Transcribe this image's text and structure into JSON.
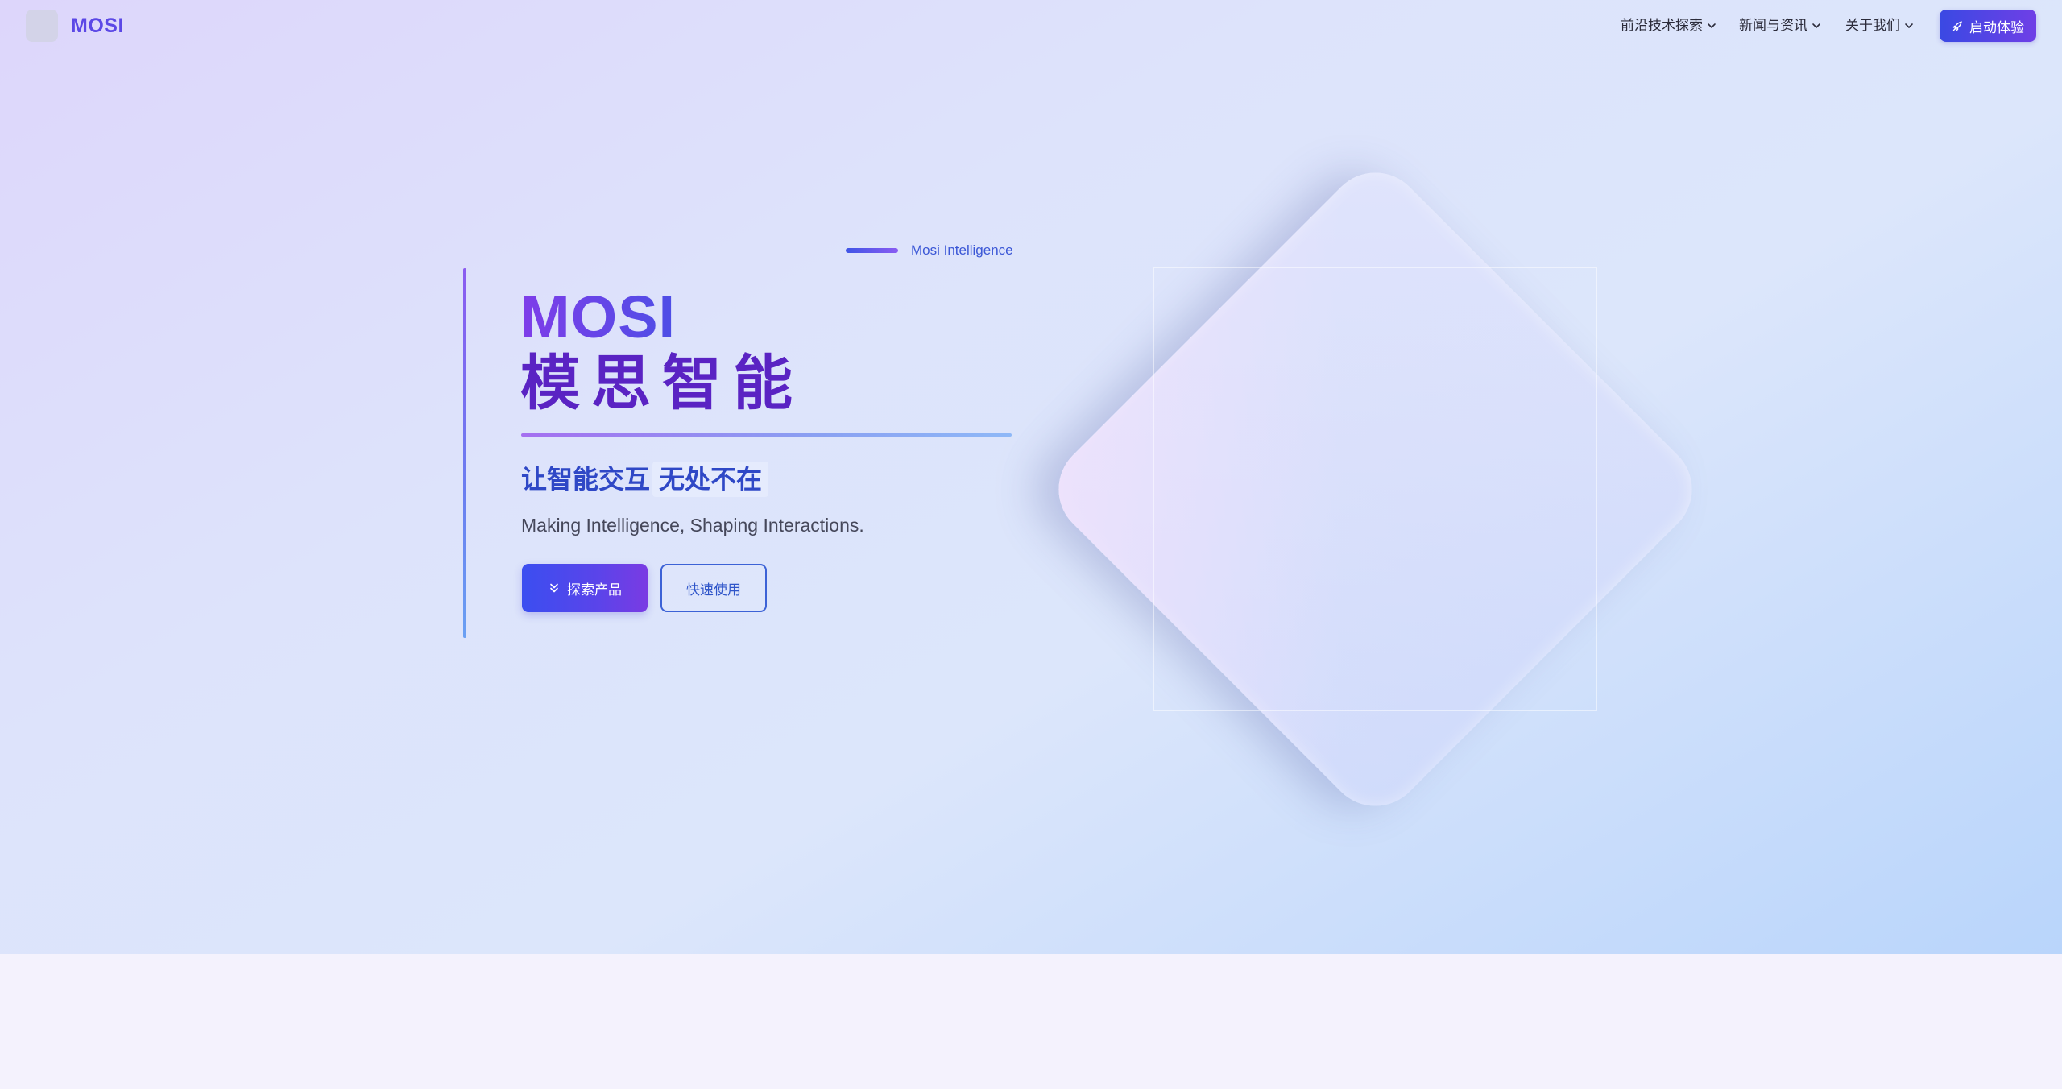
{
  "header": {
    "logo_text": "MOSI",
    "nav": [
      {
        "label": "前沿技术探索"
      },
      {
        "label": "新闻与资讯"
      },
      {
        "label": "关于我们"
      }
    ],
    "cta_label": "启动体验"
  },
  "hero": {
    "eyebrow": "Mosi Intelligence",
    "title_en": "MOSI",
    "title_cn": "模思智能",
    "tagline_a": "让智能交互",
    "tagline_b": "无处不在",
    "subtitle": "Making Intelligence, Shaping Interactions.",
    "primary_button": "探索产品",
    "secondary_button": "快速使用"
  },
  "colors": {
    "accent": "#5b48e6",
    "title_cn": "#5a23c3",
    "tagline": "#2f48c6"
  },
  "icons": {
    "nav_chevron": "chevron-down-icon",
    "cta": "rocket-icon",
    "primary_button": "double-chevron-down-icon"
  }
}
